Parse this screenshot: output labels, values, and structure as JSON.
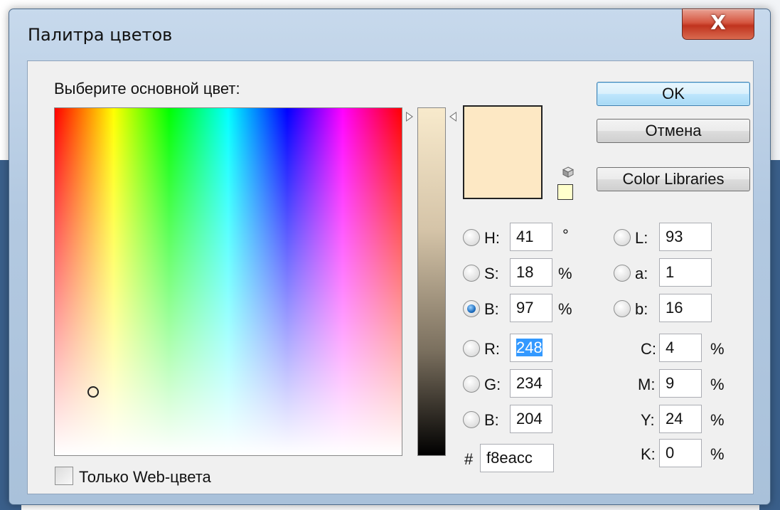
{
  "window": {
    "title": "Палитра цветов",
    "close_glyph": "X"
  },
  "label_pick": "Выберите основной цвет:",
  "buttons": {
    "ok": "OK",
    "cancel": "Отмена",
    "libraries": "Color Libraries"
  },
  "current_color": "#fde8c4",
  "websafe_color": "#ffffcc",
  "icons": {
    "out_of_gamut": "cube-icon",
    "websafe": "websafe-swatch"
  },
  "hsb": {
    "h": {
      "label": "H:",
      "value": "41",
      "unit": "°"
    },
    "s": {
      "label": "S:",
      "value": "18",
      "unit": "%"
    },
    "b": {
      "label": "B:",
      "value": "97",
      "unit": "%"
    },
    "selected": "b"
  },
  "lab": {
    "l": {
      "label": "L:",
      "value": "93"
    },
    "a": {
      "label": "a:",
      "value": "1"
    },
    "b": {
      "label": "b:",
      "value": "16"
    }
  },
  "rgb": {
    "r": {
      "label": "R:",
      "value": "248"
    },
    "g": {
      "label": "G:",
      "value": "234"
    },
    "b": {
      "label": "B:",
      "value": "204"
    }
  },
  "cmyk": {
    "c": {
      "label": "C:",
      "value": "4",
      "unit": "%"
    },
    "m": {
      "label": "M:",
      "value": "9",
      "unit": "%"
    },
    "y": {
      "label": "Y:",
      "value": "24",
      "unit": "%"
    },
    "k": {
      "label": "K:",
      "value": "0",
      "unit": "%"
    }
  },
  "hex": {
    "label": "#",
    "value": "f8eacc"
  },
  "web_only": {
    "label": "Только Web-цвета",
    "checked": false
  }
}
